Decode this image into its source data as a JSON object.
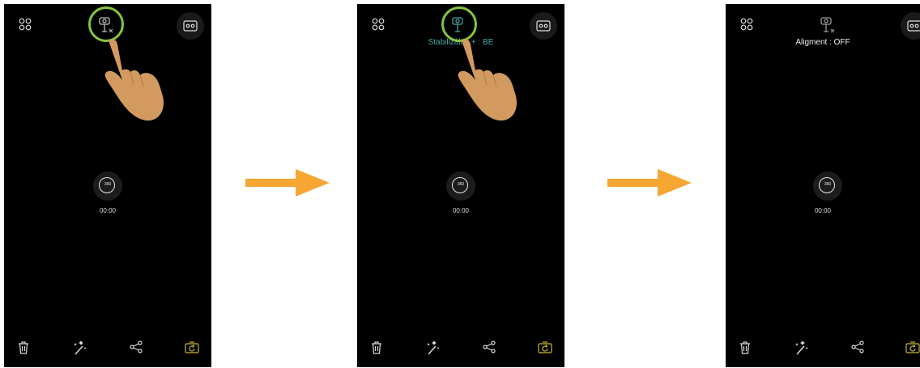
{
  "colors": {
    "phone_bg": "#000000",
    "accent_green_ring": "#86c540",
    "status_teal": "#44a6a3",
    "rotate_yellow": "#c9b73a",
    "arrow_orange": "#f5a633",
    "hand_skin": "#d39a5f"
  },
  "icons": [
    "grid-icon",
    "gimbal-icon",
    "vr-view-icon",
    "360-mode-icon",
    "trash-icon",
    "magic-wand-icon",
    "share-icon",
    "rotate-camera-icon",
    "hand-pointer-icon",
    "arrow-right-icon"
  ],
  "screens": [
    {
      "status_text": "",
      "camera_label": "360",
      "timer": "00:00",
      "gimbal_state": "off",
      "tap_highlight": true
    },
    {
      "status_text": "Stabilizálás + : BE",
      "camera_label": "360",
      "timer": "00:00",
      "gimbal_state": "on",
      "tap_highlight": true
    },
    {
      "status_text": "Aligment : OFF",
      "camera_label": "360",
      "timer": "00:00",
      "gimbal_state": "off",
      "tap_highlight": false
    }
  ]
}
